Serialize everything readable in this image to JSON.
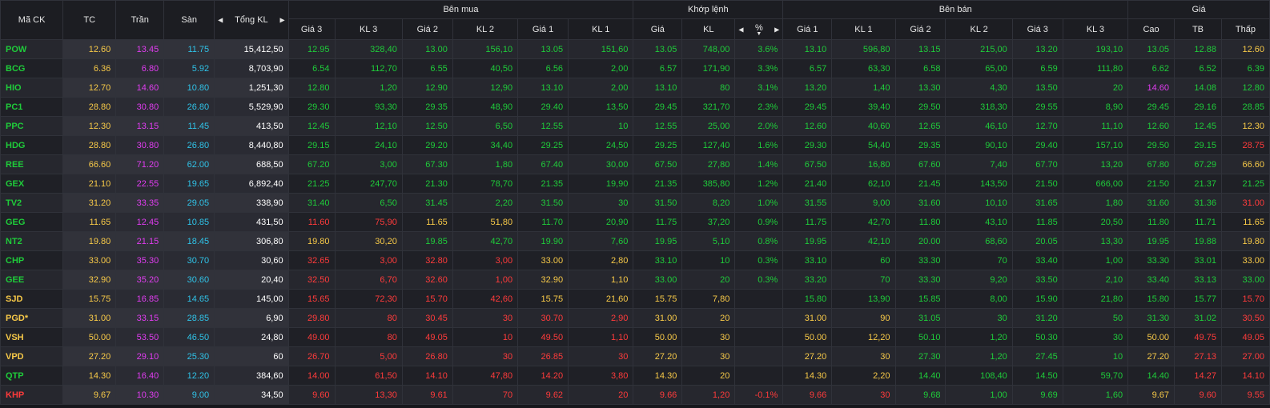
{
  "header": {
    "symbol": "Mã CK",
    "ref": "TC",
    "ceiling": "Trần",
    "floor": "Sàn",
    "total_volume": "Tổng KL",
    "buy_group": "Bên mua",
    "match_group": "Khớp lệnh",
    "sell_group": "Bên bán",
    "price_group": "Giá",
    "buy_cols": [
      "Giá 3",
      "KL 3",
      "Giá 2",
      "KL 2",
      "Giá 1",
      "KL 1"
    ],
    "match_price": "Giá",
    "match_volume": "KL",
    "match_pct": "%",
    "sell_cols": [
      "Giá 1",
      "KL 1",
      "Giá 2",
      "KL 2",
      "Giá 3",
      "KL 3"
    ],
    "price_cols": [
      "Cao",
      "TB",
      "Thấp"
    ]
  },
  "rows": [
    {
      "sym": "POW",
      "sc": "up",
      "ref": "12.60",
      "ceil": "13.45",
      "floor": "11.75",
      "tot": "15,412,50",
      "b3p": "12.95",
      "b3pc": "up",
      "b3v": "328,40",
      "b2p": "13.00",
      "b2pc": "up",
      "b2v": "156,10",
      "b1p": "13.05",
      "b1pc": "up",
      "b1v": "151,60",
      "mp": "13.05",
      "mpc": "up",
      "mv": "748,00",
      "pct": "3.6%",
      "s1p": "13.10",
      "s1pc": "up",
      "s1v": "596,80",
      "s2p": "13.15",
      "s2pc": "up",
      "s2v": "215,00",
      "s3p": "13.20",
      "s3pc": "up",
      "s3v": "193,10",
      "hi": "13.05",
      "hic": "up",
      "avg": "12.88",
      "avgc": "up",
      "lo": "12.60",
      "loc": "ref"
    },
    {
      "sym": "BCG",
      "sc": "up",
      "ref": "6.36",
      "ceil": "6.80",
      "floor": "5.92",
      "tot": "8,703,90",
      "b3p": "6.54",
      "b3pc": "up",
      "b3v": "112,70",
      "b2p": "6.55",
      "b2pc": "up",
      "b2v": "40,50",
      "b1p": "6.56",
      "b1pc": "up",
      "b1v": "2,00",
      "mp": "6.57",
      "mpc": "up",
      "mv": "171,90",
      "pct": "3.3%",
      "s1p": "6.57",
      "s1pc": "up",
      "s1v": "63,30",
      "s2p": "6.58",
      "s2pc": "up",
      "s2v": "65,00",
      "s3p": "6.59",
      "s3pc": "up",
      "s3v": "111,80",
      "hi": "6.62",
      "hic": "up",
      "avg": "6.52",
      "avgc": "up",
      "lo": "6.39",
      "loc": "up"
    },
    {
      "sym": "HIO",
      "sc": "up",
      "ref": "12.70",
      "ceil": "14.60",
      "floor": "10.80",
      "tot": "1,251,30",
      "b3p": "12.80",
      "b3pc": "up",
      "b3v": "1,20",
      "b2p": "12.90",
      "b2pc": "up",
      "b2v": "12,90",
      "b1p": "13.10",
      "b1pc": "up",
      "b1v": "2,00",
      "mp": "13.10",
      "mpc": "up",
      "mv": "80",
      "pct": "3.1%",
      "s1p": "13.20",
      "s1pc": "up",
      "s1v": "1,40",
      "s2p": "13.30",
      "s2pc": "up",
      "s2v": "4,30",
      "s3p": "13.50",
      "s3pc": "up",
      "s3v": "20",
      "hi": "14.60",
      "hic": "ceil",
      "avg": "14.08",
      "avgc": "up",
      "lo": "12.80",
      "loc": "up"
    },
    {
      "sym": "PC1",
      "sc": "up",
      "ref": "28.80",
      "ceil": "30.80",
      "floor": "26.80",
      "tot": "5,529,90",
      "b3p": "29.30",
      "b3pc": "up",
      "b3v": "93,30",
      "b2p": "29.35",
      "b2pc": "up",
      "b2v": "48,90",
      "b1p": "29.40",
      "b1pc": "up",
      "b1v": "13,50",
      "mp": "29.45",
      "mpc": "up",
      "mv": "321,70",
      "pct": "2.3%",
      "s1p": "29.45",
      "s1pc": "up",
      "s1v": "39,40",
      "s2p": "29.50",
      "s2pc": "up",
      "s2v": "318,30",
      "s3p": "29.55",
      "s3pc": "up",
      "s3v": "8,90",
      "hi": "29.45",
      "hic": "up",
      "avg": "29.16",
      "avgc": "up",
      "lo": "28.85",
      "loc": "up"
    },
    {
      "sym": "PPC",
      "sc": "up",
      "ref": "12.30",
      "ceil": "13.15",
      "floor": "11.45",
      "tot": "413,50",
      "b3p": "12.45",
      "b3pc": "up",
      "b3v": "12,10",
      "b2p": "12.50",
      "b2pc": "up",
      "b2v": "6,50",
      "b1p": "12.55",
      "b1pc": "up",
      "b1v": "10",
      "mp": "12.55",
      "mpc": "up",
      "mv": "25,00",
      "pct": "2.0%",
      "s1p": "12.60",
      "s1pc": "up",
      "s1v": "40,60",
      "s2p": "12.65",
      "s2pc": "up",
      "s2v": "46,10",
      "s3p": "12.70",
      "s3pc": "up",
      "s3v": "11,10",
      "hi": "12.60",
      "hic": "up",
      "avg": "12.45",
      "avgc": "up",
      "lo": "12.30",
      "loc": "ref"
    },
    {
      "sym": "HDG",
      "sc": "up",
      "ref": "28.80",
      "ceil": "30.80",
      "floor": "26.80",
      "tot": "8,440,80",
      "b3p": "29.15",
      "b3pc": "up",
      "b3v": "24,10",
      "b2p": "29.20",
      "b2pc": "up",
      "b2v": "34,40",
      "b1p": "29.25",
      "b1pc": "up",
      "b1v": "24,50",
      "mp": "29.25",
      "mpc": "up",
      "mv": "127,40",
      "pct": "1.6%",
      "s1p": "29.30",
      "s1pc": "up",
      "s1v": "54,40",
      "s2p": "29.35",
      "s2pc": "up",
      "s2v": "90,10",
      "s3p": "29.40",
      "s3pc": "up",
      "s3v": "157,10",
      "hi": "29.50",
      "hic": "up",
      "avg": "29.15",
      "avgc": "up",
      "lo": "28.75",
      "loc": "down"
    },
    {
      "sym": "REE",
      "sc": "up",
      "ref": "66.60",
      "ceil": "71.20",
      "floor": "62.00",
      "tot": "688,50",
      "b3p": "67.20",
      "b3pc": "up",
      "b3v": "3,00",
      "b2p": "67.30",
      "b2pc": "up",
      "b2v": "1,80",
      "b1p": "67.40",
      "b1pc": "up",
      "b1v": "30,00",
      "mp": "67.50",
      "mpc": "up",
      "mv": "27,80",
      "pct": "1.4%",
      "s1p": "67.50",
      "s1pc": "up",
      "s1v": "16,80",
      "s2p": "67.60",
      "s2pc": "up",
      "s2v": "7,40",
      "s3p": "67.70",
      "s3pc": "up",
      "s3v": "13,20",
      "hi": "67.80",
      "hic": "up",
      "avg": "67.29",
      "avgc": "up",
      "lo": "66.60",
      "loc": "ref"
    },
    {
      "sym": "GEX",
      "sc": "up",
      "ref": "21.10",
      "ceil": "22.55",
      "floor": "19.65",
      "tot": "6,892,40",
      "b3p": "21.25",
      "b3pc": "up",
      "b3v": "247,70",
      "b2p": "21.30",
      "b2pc": "up",
      "b2v": "78,70",
      "b1p": "21.35",
      "b1pc": "up",
      "b1v": "19,90",
      "mp": "21.35",
      "mpc": "up",
      "mv": "385,80",
      "pct": "1.2%",
      "s1p": "21.40",
      "s1pc": "up",
      "s1v": "62,10",
      "s2p": "21.45",
      "s2pc": "up",
      "s2v": "143,50",
      "s3p": "21.50",
      "s3pc": "up",
      "s3v": "666,00",
      "hi": "21.50",
      "hic": "up",
      "avg": "21.37",
      "avgc": "up",
      "lo": "21.25",
      "loc": "up"
    },
    {
      "sym": "TV2",
      "sc": "up",
      "ref": "31.20",
      "ceil": "33.35",
      "floor": "29.05",
      "tot": "338,90",
      "b3p": "31.40",
      "b3pc": "up",
      "b3v": "6,50",
      "b2p": "31.45",
      "b2pc": "up",
      "b2v": "2,20",
      "b1p": "31.50",
      "b1pc": "up",
      "b1v": "30",
      "mp": "31.50",
      "mpc": "up",
      "mv": "8,20",
      "pct": "1.0%",
      "s1p": "31.55",
      "s1pc": "up",
      "s1v": "9,00",
      "s2p": "31.60",
      "s2pc": "up",
      "s2v": "10,10",
      "s3p": "31.65",
      "s3pc": "up",
      "s3v": "1,80",
      "hi": "31.60",
      "hic": "up",
      "avg": "31.36",
      "avgc": "up",
      "lo": "31.00",
      "loc": "down"
    },
    {
      "sym": "GEG",
      "sc": "up",
      "ref": "11.65",
      "ceil": "12.45",
      "floor": "10.85",
      "tot": "431,50",
      "b3p": "11.60",
      "b3pc": "down",
      "b3v": "75,90",
      "b2p": "11.65",
      "b2pc": "ref",
      "b2v": "51,80",
      "b1p": "11.70",
      "b1pc": "up",
      "b1v": "20,90",
      "mp": "11.75",
      "mpc": "up",
      "mv": "37,20",
      "pct": "0.9%",
      "s1p": "11.75",
      "s1pc": "up",
      "s1v": "42,70",
      "s2p": "11.80",
      "s2pc": "up",
      "s2v": "43,10",
      "s3p": "11.85",
      "s3pc": "up",
      "s3v": "20,50",
      "hi": "11.80",
      "hic": "up",
      "avg": "11.71",
      "avgc": "up",
      "lo": "11.65",
      "loc": "ref"
    },
    {
      "sym": "NT2",
      "sc": "up",
      "ref": "19.80",
      "ceil": "21.15",
      "floor": "18.45",
      "tot": "306,80",
      "b3p": "19.80",
      "b3pc": "ref",
      "b3v": "30,20",
      "b2p": "19.85",
      "b2pc": "up",
      "b2v": "42,70",
      "b1p": "19.90",
      "b1pc": "up",
      "b1v": "7,60",
      "mp": "19.95",
      "mpc": "up",
      "mv": "5,10",
      "pct": "0.8%",
      "s1p": "19.95",
      "s1pc": "up",
      "s1v": "42,10",
      "s2p": "20.00",
      "s2pc": "up",
      "s2v": "68,60",
      "s3p": "20.05",
      "s3pc": "up",
      "s3v": "13,30",
      "hi": "19.95",
      "hic": "up",
      "avg": "19.88",
      "avgc": "up",
      "lo": "19.80",
      "loc": "ref"
    },
    {
      "sym": "CHP",
      "sc": "up",
      "ref": "33.00",
      "ceil": "35.30",
      "floor": "30.70",
      "tot": "30,60",
      "b3p": "32.65",
      "b3pc": "down",
      "b3v": "3,00",
      "b2p": "32.80",
      "b2pc": "down",
      "b2v": "3,00",
      "b1p": "33.00",
      "b1pc": "ref",
      "b1v": "2,80",
      "mp": "33.10",
      "mpc": "up",
      "mv": "10",
      "pct": "0.3%",
      "s1p": "33.10",
      "s1pc": "up",
      "s1v": "60",
      "s2p": "33.30",
      "s2pc": "up",
      "s2v": "70",
      "s3p": "33.40",
      "s3pc": "up",
      "s3v": "1,00",
      "hi": "33.30",
      "hic": "up",
      "avg": "33.01",
      "avgc": "up",
      "lo": "33.00",
      "loc": "ref"
    },
    {
      "sym": "GEE",
      "sc": "up",
      "ref": "32.90",
      "ceil": "35.20",
      "floor": "30.60",
      "tot": "20,40",
      "b3p": "32.50",
      "b3pc": "down",
      "b3v": "6,70",
      "b2p": "32.60",
      "b2pc": "down",
      "b2v": "1,00",
      "b1p": "32.90",
      "b1pc": "ref",
      "b1v": "1,10",
      "mp": "33.00",
      "mpc": "up",
      "mv": "20",
      "pct": "0.3%",
      "s1p": "33.20",
      "s1pc": "up",
      "s1v": "70",
      "s2p": "33.30",
      "s2pc": "up",
      "s2v": "9,20",
      "s3p": "33.50",
      "s3pc": "up",
      "s3v": "2,10",
      "hi": "33.40",
      "hic": "up",
      "avg": "33.13",
      "avgc": "up",
      "lo": "33.00",
      "loc": "up"
    },
    {
      "sym": "SJD",
      "sc": "ref",
      "ref": "15.75",
      "ceil": "16.85",
      "floor": "14.65",
      "tot": "145,00",
      "b3p": "15.65",
      "b3pc": "down",
      "b3v": "72,30",
      "b2p": "15.70",
      "b2pc": "down",
      "b2v": "42,60",
      "b1p": "15.75",
      "b1pc": "ref",
      "b1v": "21,60",
      "mp": "15.75",
      "mpc": "ref",
      "mv": "7,80",
      "pct": "",
      "s1p": "15.80",
      "s1pc": "up",
      "s1v": "13,90",
      "s2p": "15.85",
      "s2pc": "up",
      "s2v": "8,00",
      "s3p": "15.90",
      "s3pc": "up",
      "s3v": "21,80",
      "hi": "15.80",
      "hic": "up",
      "avg": "15.77",
      "avgc": "up",
      "lo": "15.70",
      "loc": "down"
    },
    {
      "sym": "PGD*",
      "sc": "ref",
      "ref": "31.00",
      "ceil": "33.15",
      "floor": "28.85",
      "tot": "6,90",
      "b3p": "29.80",
      "b3pc": "down",
      "b3v": "80",
      "b2p": "30.45",
      "b2pc": "down",
      "b2v": "30",
      "b1p": "30.70",
      "b1pc": "down",
      "b1v": "2,90",
      "mp": "31.00",
      "mpc": "ref",
      "mv": "20",
      "pct": "",
      "s1p": "31.00",
      "s1pc": "ref",
      "s1v": "90",
      "s2p": "31.05",
      "s2pc": "up",
      "s2v": "30",
      "s3p": "31.20",
      "s3pc": "up",
      "s3v": "50",
      "hi": "31.30",
      "hic": "up",
      "avg": "31.02",
      "avgc": "up",
      "lo": "30.50",
      "loc": "down"
    },
    {
      "sym": "VSH",
      "sc": "ref",
      "ref": "50.00",
      "ceil": "53.50",
      "floor": "46.50",
      "tot": "24,80",
      "b3p": "49.00",
      "b3pc": "down",
      "b3v": "80",
      "b2p": "49.05",
      "b2pc": "down",
      "b2v": "10",
      "b1p": "49.50",
      "b1pc": "down",
      "b1v": "1,10",
      "mp": "50.00",
      "mpc": "ref",
      "mv": "30",
      "pct": "",
      "s1p": "50.00",
      "s1pc": "ref",
      "s1v": "12,20",
      "s2p": "50.10",
      "s2pc": "up",
      "s2v": "1,20",
      "s3p": "50.30",
      "s3pc": "up",
      "s3v": "30",
      "hi": "50.00",
      "hic": "ref",
      "avg": "49.75",
      "avgc": "down",
      "lo": "49.05",
      "loc": "down"
    },
    {
      "sym": "VPD",
      "sc": "ref",
      "ref": "27.20",
      "ceil": "29.10",
      "floor": "25.30",
      "tot": "60",
      "b3p": "26.70",
      "b3pc": "down",
      "b3v": "5,00",
      "b2p": "26.80",
      "b2pc": "down",
      "b2v": "30",
      "b1p": "26.85",
      "b1pc": "down",
      "b1v": "30",
      "mp": "27.20",
      "mpc": "ref",
      "mv": "30",
      "pct": "",
      "s1p": "27.20",
      "s1pc": "ref",
      "s1v": "30",
      "s2p": "27.30",
      "s2pc": "up",
      "s2v": "1,20",
      "s3p": "27.45",
      "s3pc": "up",
      "s3v": "10",
      "hi": "27.20",
      "hic": "ref",
      "avg": "27.13",
      "avgc": "down",
      "lo": "27.00",
      "loc": "down"
    },
    {
      "sym": "QTP",
      "sc": "up",
      "ref": "14.30",
      "ceil": "16.40",
      "floor": "12.20",
      "tot": "384,60",
      "b3p": "14.00",
      "b3pc": "down",
      "b3v": "61,50",
      "b2p": "14.10",
      "b2pc": "down",
      "b2v": "47,80",
      "b1p": "14.20",
      "b1pc": "down",
      "b1v": "3,80",
      "mp": "14.30",
      "mpc": "ref",
      "mv": "20",
      "pct": "",
      "s1p": "14.30",
      "s1pc": "ref",
      "s1v": "2,20",
      "s2p": "14.40",
      "s2pc": "up",
      "s2v": "108,40",
      "s3p": "14.50",
      "s3pc": "up",
      "s3v": "59,70",
      "hi": "14.40",
      "hic": "up",
      "avg": "14.27",
      "avgc": "down",
      "lo": "14.10",
      "loc": "down"
    },
    {
      "sym": "KHP",
      "sc": "down",
      "ref": "9.67",
      "ceil": "10.30",
      "floor": "9.00",
      "tot": "34,50",
      "b3p": "9.60",
      "b3pc": "down",
      "b3v": "13,30",
      "b2p": "9.61",
      "b2pc": "down",
      "b2v": "70",
      "b1p": "9.62",
      "b1pc": "down",
      "b1v": "20",
      "mp": "9.66",
      "mpc": "down",
      "mv": "1,20",
      "pct": "-0.1%",
      "s1p": "9.66",
      "s1pc": "down",
      "s1v": "30",
      "s2p": "9.68",
      "s2pc": "up",
      "s2v": "1,00",
      "s3p": "9.69",
      "s3pc": "up",
      "s3v": "1,60",
      "hi": "9.67",
      "hic": "ref",
      "avg": "9.60",
      "avgc": "down",
      "lo": "9.55",
      "loc": "down"
    }
  ]
}
